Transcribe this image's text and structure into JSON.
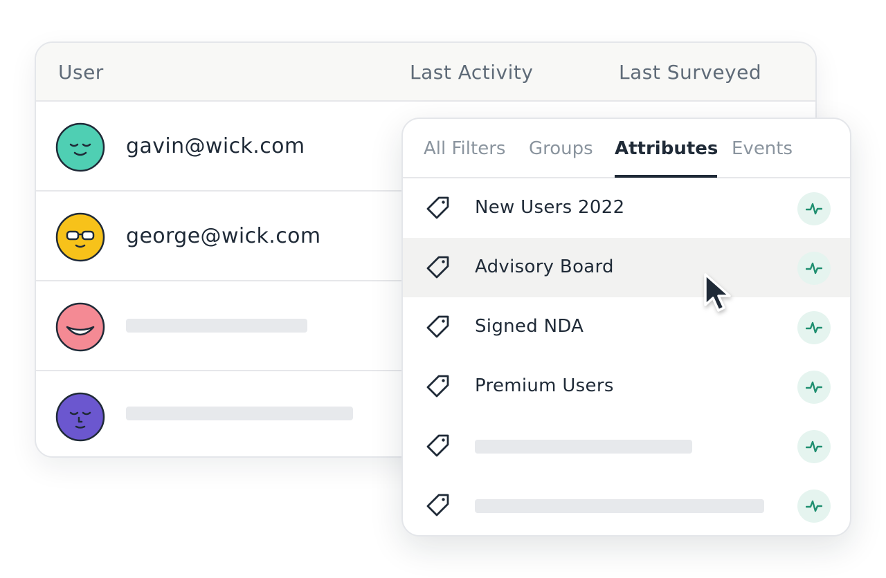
{
  "table": {
    "columns": [
      "User",
      "Last Activity",
      "Last Surveyed"
    ],
    "rows": [
      {
        "email": "gavin@wick.com",
        "avatar": "smile-face-icon",
        "avatar_color": "#4fcfb3"
      },
      {
        "email": "george@wick.com",
        "avatar": "sunglasses-face-icon",
        "avatar_color": "#f7c21a"
      },
      {
        "email": null,
        "avatar": "grin-face-icon",
        "avatar_color": "#f48a94"
      },
      {
        "email": null,
        "avatar": "sleepy-face-icon",
        "avatar_color": "#6b57cf"
      }
    ]
  },
  "filter_panel": {
    "tabs": [
      {
        "label": "All Filters",
        "active": false
      },
      {
        "label": "Groups",
        "active": false
      },
      {
        "label": "Attributes",
        "active": true
      },
      {
        "label": "Events",
        "active": false
      }
    ],
    "items": [
      {
        "label": "New Users 2022",
        "icon": "tag-icon",
        "action_icon": "pulse-icon"
      },
      {
        "label": "Advisory Board",
        "icon": "tag-icon",
        "action_icon": "pulse-icon",
        "hovered": true
      },
      {
        "label": "Signed NDA",
        "icon": "tag-icon",
        "action_icon": "pulse-icon"
      },
      {
        "label": "Premium Users",
        "icon": "tag-icon",
        "action_icon": "pulse-icon"
      },
      {
        "label": null,
        "icon": "tag-icon",
        "action_icon": "pulse-icon"
      },
      {
        "label": null,
        "icon": "tag-icon",
        "action_icon": "pulse-icon"
      }
    ]
  },
  "colors": {
    "text_primary": "#1f2a37",
    "text_muted": "#8a949e",
    "pulse_accent": "#1f8f70",
    "pulse_bg": "#e5f4ef",
    "skeleton": "#e7e9ec",
    "hover_row": "#f2f2f1"
  }
}
